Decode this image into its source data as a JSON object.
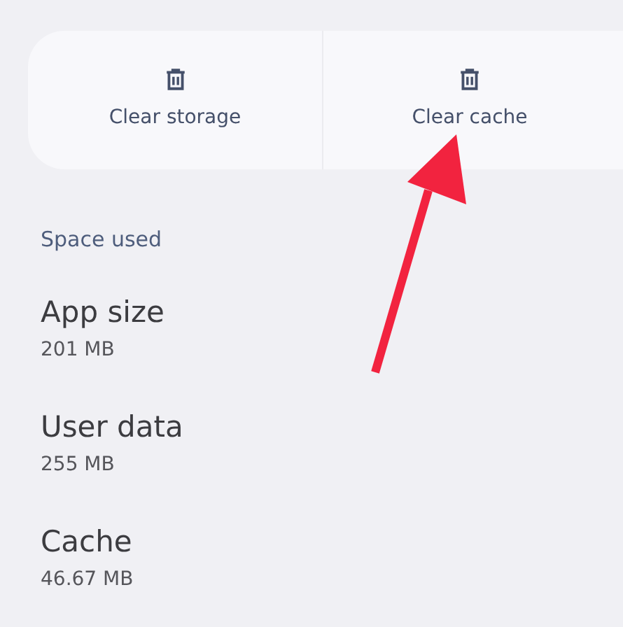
{
  "actions": [
    {
      "label": "Clear storage"
    },
    {
      "label": "Clear cache"
    }
  ],
  "section_title": "Space used",
  "items": [
    {
      "title": "App size",
      "value": "201 MB"
    },
    {
      "title": "User data",
      "value": "255 MB"
    },
    {
      "title": "Cache",
      "value": "46.67 MB"
    }
  ],
  "annotation": {
    "kind": "arrow"
  }
}
